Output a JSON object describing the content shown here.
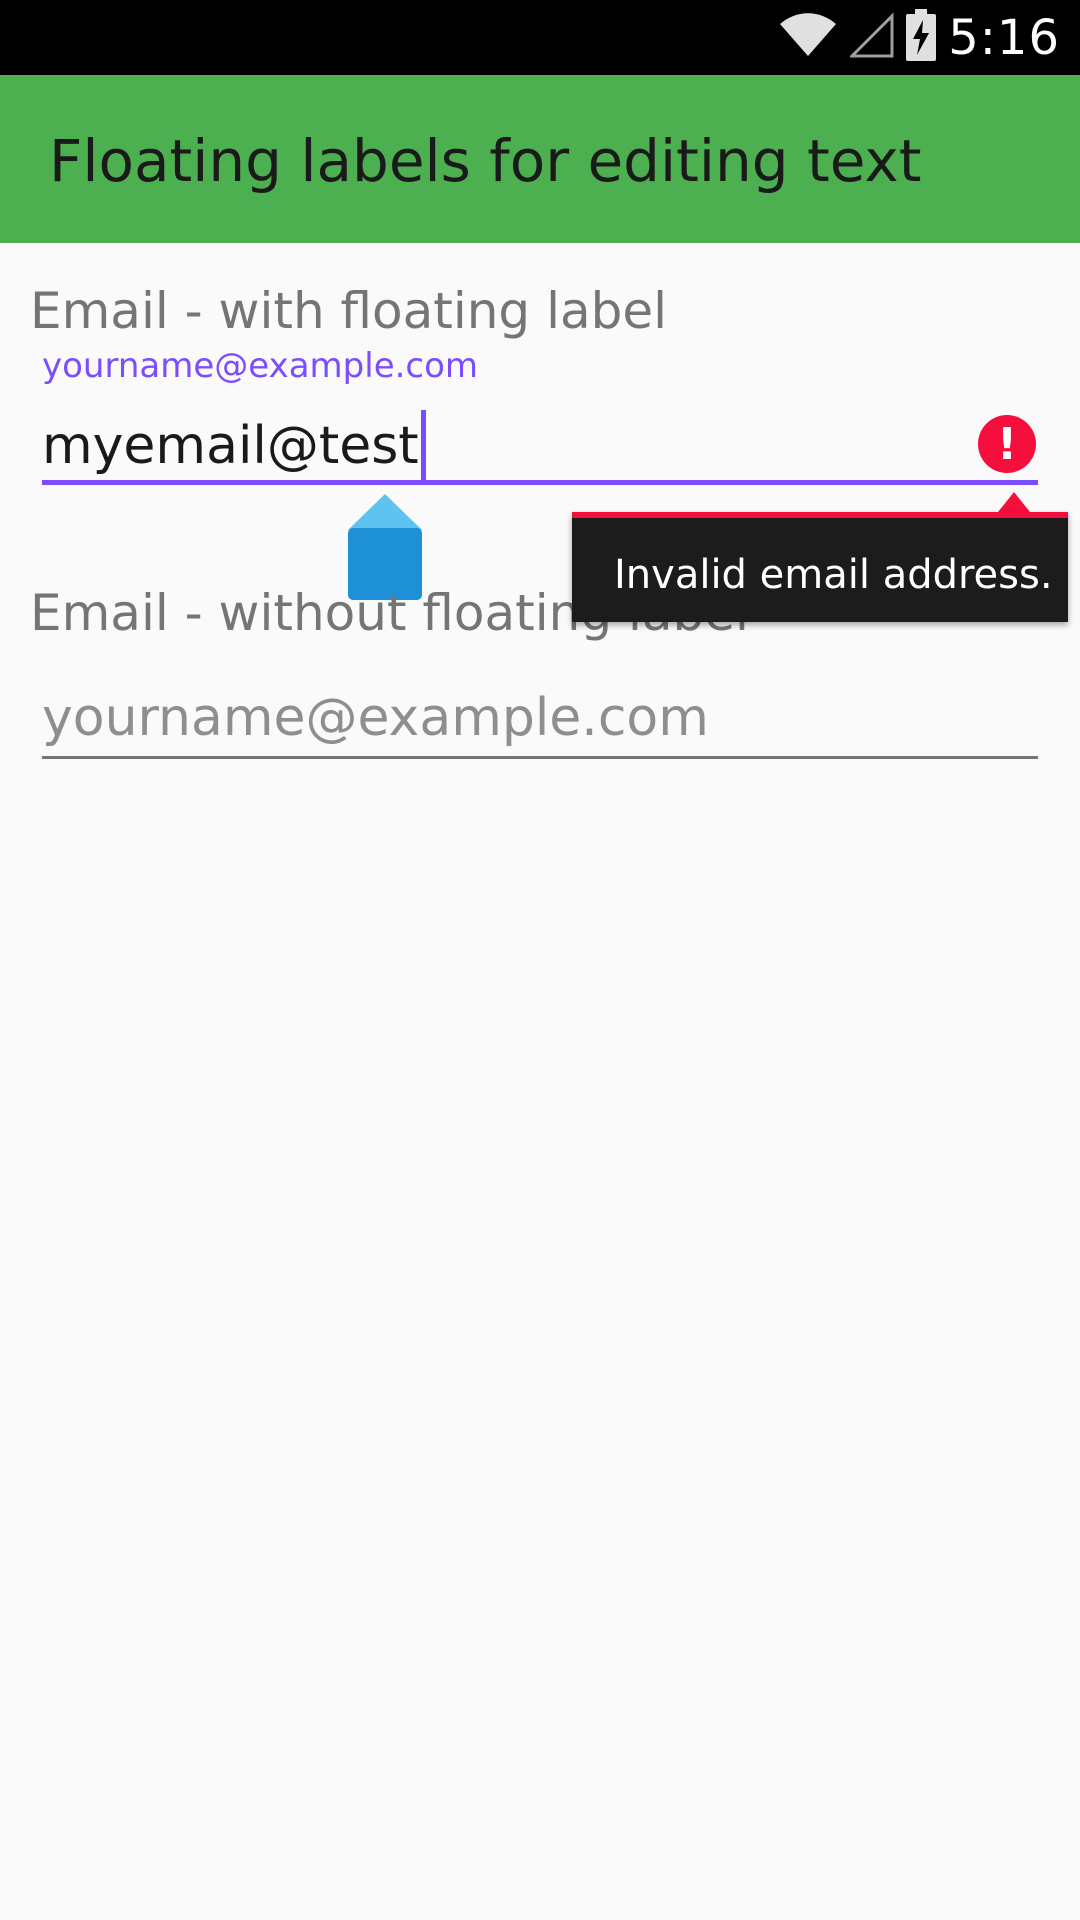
{
  "status_bar": {
    "time": "5:16",
    "icons": [
      "wifi-icon",
      "signal-icon",
      "battery-charging-icon"
    ]
  },
  "app_bar": {
    "title": "Floating labels for editing text",
    "color": "#4caf50"
  },
  "field_floating": {
    "section_label": "Email - with floating label",
    "floating_hint": "yourname@example.com",
    "value": "myemail@test",
    "error_icon": "error-icon",
    "error_message": "Invalid email address."
  },
  "field_plain": {
    "section_label": "Email - without floating label",
    "placeholder": "yourname@example.com"
  },
  "colors": {
    "accent": "#7c4dff",
    "error": "#f50f3c",
    "handle": "#1e90d6"
  }
}
